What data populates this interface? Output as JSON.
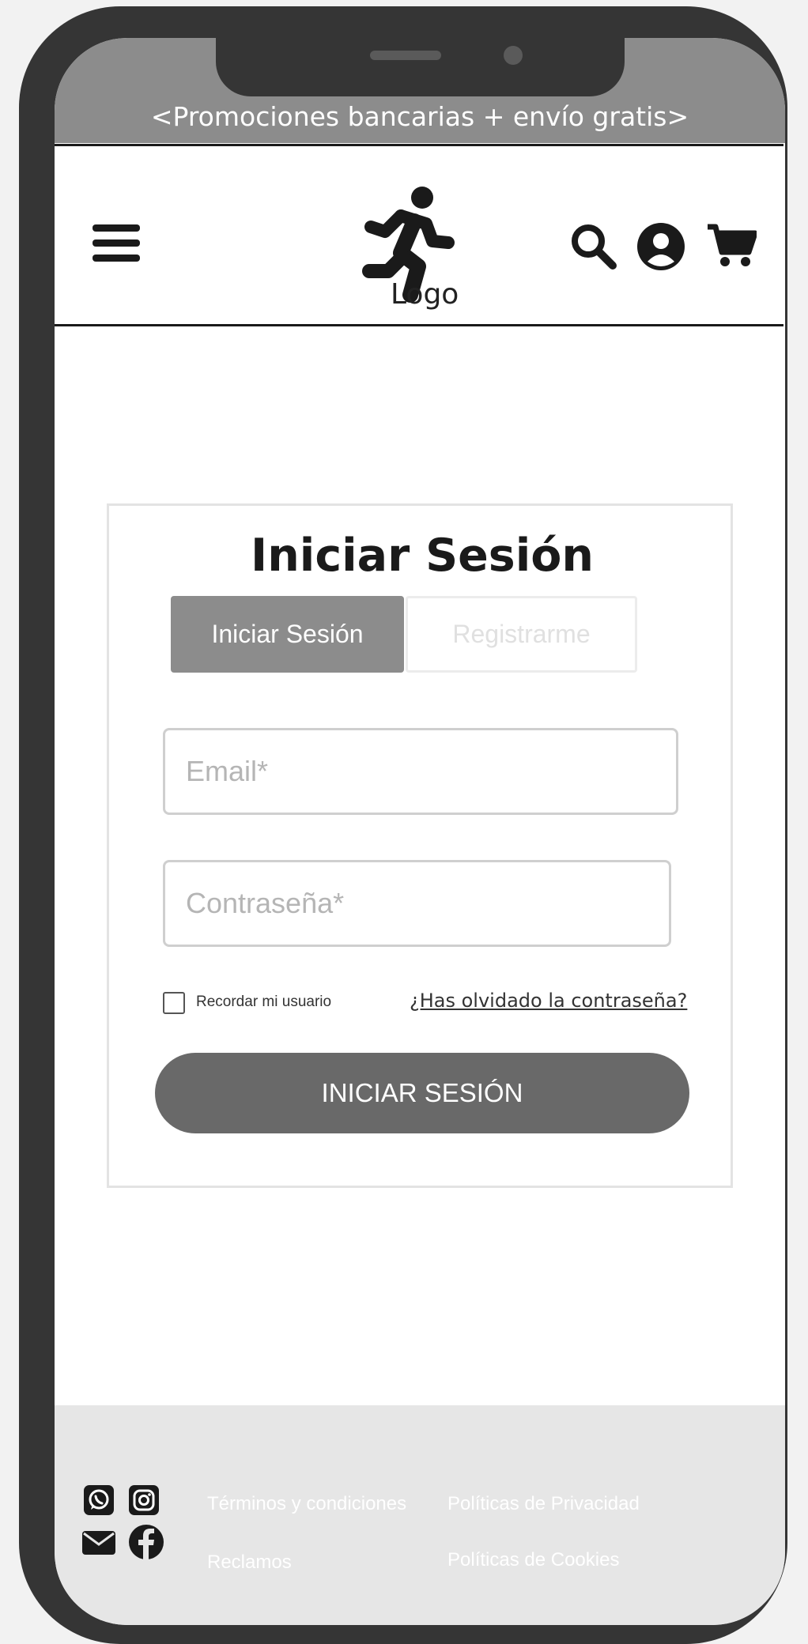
{
  "promo_banner": {
    "text": "<Promociones bancarias + envío gratis>"
  },
  "header": {
    "logo_text": "Logo",
    "icons": [
      "menu-icon",
      "search-icon",
      "user-icon",
      "cart-icon"
    ]
  },
  "login": {
    "title": "Iniciar Sesión",
    "tabs": [
      {
        "label": "Iniciar Sesión",
        "active": true
      },
      {
        "label": "Registrarme",
        "active": false
      }
    ],
    "email_placeholder": "Email*",
    "password_placeholder": "Contraseña*",
    "remember_label": "Recordar mi usuario",
    "remember_checked": false,
    "forgot_link": "¿Has olvidado la contraseña?",
    "submit_label": "INICIAR SESIÓN"
  },
  "footer": {
    "social_icons": [
      "whatsapp-icon",
      "instagram-icon",
      "mail-icon",
      "facebook-icon"
    ],
    "links": [
      "Términos y condiciones",
      "Políticas de Privacidad",
      "Reclamos",
      "Políticas de Cookies"
    ]
  },
  "colors": {
    "frame": "#353535",
    "banner": "#8c8c8c",
    "active_tab": "#8c8c8c",
    "submit_button": "#696969",
    "footer": "#e6e6e6"
  }
}
